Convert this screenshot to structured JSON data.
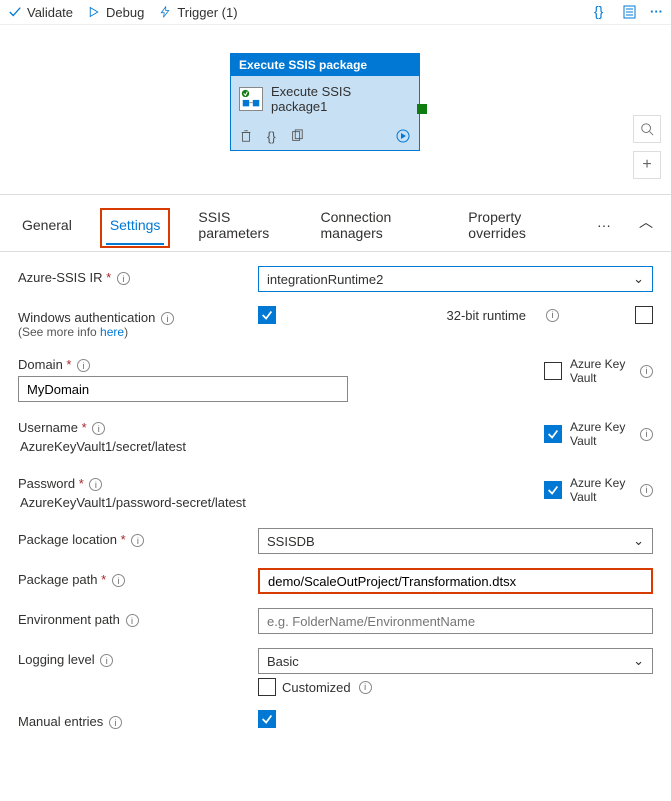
{
  "toolbar": {
    "validate": "Validate",
    "debug": "Debug",
    "trigger": "Trigger (1)"
  },
  "node": {
    "header": "Execute SSIS package",
    "title": "Execute SSIS package1"
  },
  "tabs": {
    "general": "General",
    "settings": "Settings",
    "ssis_params": "SSIS parameters",
    "conn_mgrs": "Connection managers",
    "prop_over": "Property overrides",
    "more": "···"
  },
  "form": {
    "azure_ssis_ir": {
      "label": "Azure-SSIS IR",
      "value": "integrationRuntime2"
    },
    "win_auth": {
      "label": "Windows authentication",
      "note_prefix": "(See more info ",
      "note_link": "here",
      "note_suffix": ")"
    },
    "runtime32": {
      "label": "32-bit runtime"
    },
    "domain": {
      "label": "Domain",
      "value": "MyDomain"
    },
    "username": {
      "label": "Username",
      "value": "AzureKeyVault1/secret/latest"
    },
    "password": {
      "label": "Password",
      "value": "AzureKeyVault1/password-secret/latest"
    },
    "akv": "Azure Key Vault",
    "pkg_loc": {
      "label": "Package location",
      "value": "SSISDB"
    },
    "pkg_path": {
      "label": "Package path",
      "value": "demo/ScaleOutProject/Transformation.dtsx"
    },
    "env_path": {
      "label": "Environment path",
      "placeholder": "e.g. FolderName/EnvironmentName"
    },
    "log_level": {
      "label": "Logging level",
      "value": "Basic",
      "customized": "Customized"
    },
    "manual": {
      "label": "Manual entries"
    }
  }
}
